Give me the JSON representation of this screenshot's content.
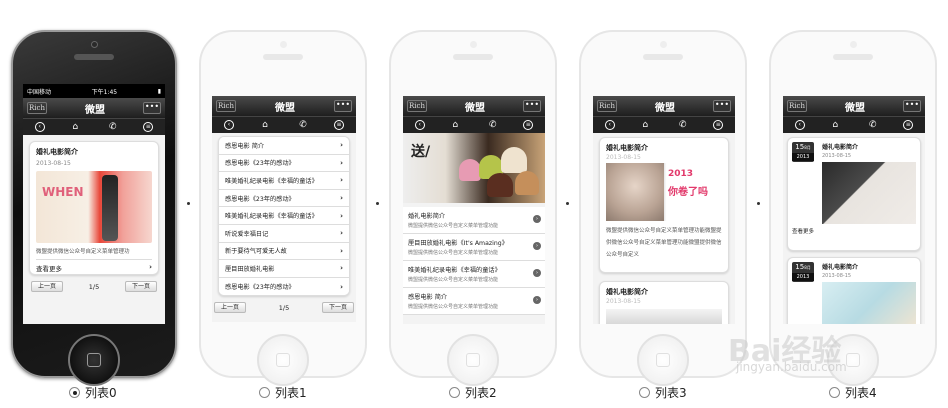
{
  "common": {
    "nav_logo": "Rich",
    "nav_title": "微盟",
    "nav_more": "•••",
    "status_carrier": "中国移动",
    "status_time": "下午1:45",
    "pager_prev": "上一页",
    "pager_next": "下一页",
    "pager_page": "1/5"
  },
  "phone0": {
    "card_title": "婚礼电影简介",
    "card_date": "2013-08-15",
    "image_text": "WHEN",
    "card_desc": "微盟提供微信公众号自定义菜单管理功",
    "more": "查看更多"
  },
  "phone1": {
    "items": [
      "感恩电影 简介",
      "感恩电影《23年的感动》",
      "唯美婚礼纪录电影《幸福的童话》",
      "感恩电影《23年的感动》",
      "唯美婚礼纪录电影《幸福的童话》",
      "听说爱幸福日记",
      "新于要待气可爱无人故",
      "厘目田放婚礼电影",
      "感恩电影《23年的感动》"
    ]
  },
  "phone2": {
    "banner_text": "送/",
    "items": [
      {
        "title": "婚礼电影简介",
        "desc": "微盟提供微信公众号自定义菜单管理功能"
      },
      {
        "title": "厘目田放婚礼电影《It's Amazing》",
        "desc": "微盟提供微信公众号自定义菜单管理功能"
      },
      {
        "title": "唯美婚礼纪录电影《幸福的童话》",
        "desc": "微盟提供微信公众号自定义菜单管理功能"
      },
      {
        "title": "感恩电影 简介",
        "desc": "微盟提供微信公众号自定义菜单管理功能"
      }
    ]
  },
  "phone3": {
    "card_title": "婚礼电影简介",
    "card_date": "2013-08-15",
    "ad_year": "2013",
    "ad_text": "你卷了吗",
    "card_desc": "微盟提供微信公众号自定义菜单管理功能微盟提供微信公众号自定义菜单管理功能微盟提供微信公众号自定义",
    "card2_title": "婚礼电影简介",
    "card2_date": "2013-08-15"
  },
  "phone4": {
    "items": [
      {
        "day": "15",
        "month": "8月",
        "year": "2013",
        "title": "婚礼电影简介",
        "date": "2013-08-15",
        "more": "查看更多"
      },
      {
        "day": "15",
        "month": "8月",
        "year": "2013",
        "title": "婚礼电影简介",
        "date": "2013-08-15"
      }
    ]
  },
  "options": [
    {
      "label": "列表0",
      "selected": true
    },
    {
      "label": "列表1",
      "selected": false
    },
    {
      "label": "列表2",
      "selected": false
    },
    {
      "label": "列表3",
      "selected": false
    },
    {
      "label": "列表4",
      "selected": false
    }
  ],
  "watermark": {
    "main": "Bai经验",
    "sub": "jingyan.baidu.com"
  }
}
